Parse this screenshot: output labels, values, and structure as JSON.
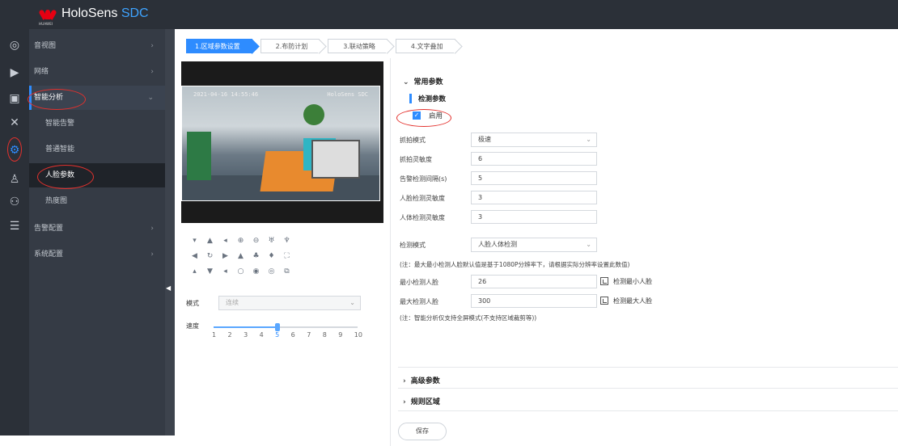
{
  "header": {
    "brand_main": "HoloSens ",
    "brand_accent": "SDC",
    "brand_sub": "HUAWEI"
  },
  "colors": {
    "accent": "#2e8cff",
    "highlight_ellipse": "#e3312d",
    "brand_red": "#e60012",
    "nav_bg": "#2b3038"
  },
  "icon_bar": [
    "camera-icon",
    "video-icon",
    "image-icon",
    "tools-icon",
    "gear-icon",
    "person-search-icon",
    "people-icon",
    "log-icon"
  ],
  "sidebar": {
    "items": [
      {
        "label": "音视图"
      },
      {
        "label": "网络"
      },
      {
        "label": "智能分析"
      },
      {
        "label": "智能告警"
      },
      {
        "label": "普通智能"
      },
      {
        "label": "人脸参数"
      },
      {
        "label": "热度图"
      },
      {
        "label": "告警配置"
      },
      {
        "label": "系统配置"
      }
    ]
  },
  "steps": [
    "1.区域参数设置",
    "2.布防计划",
    "3.联动策略",
    "4.文字叠加"
  ],
  "video": {
    "osd_time": "2021-04-16 14:55:46",
    "osd_brand": "HoloSens SDC"
  },
  "ptz": {
    "mode_label": "模式",
    "mode_value": "连续",
    "speed_label": "速度",
    "speed_value": 5,
    "speed_min": 1,
    "speed_max": 10,
    "speed_ticks": [
      "1",
      "2",
      "3",
      "4",
      "5",
      "6",
      "7",
      "8",
      "9",
      "10"
    ]
  },
  "panel": {
    "common_params": "常用参数",
    "detect_params": "检测参数",
    "enable_label": "启用",
    "enabled": true,
    "fields": [
      {
        "label": "抓拍模式",
        "value": "极速",
        "type": "select"
      },
      {
        "label": "抓拍灵敏度",
        "value": "6",
        "type": "input"
      },
      {
        "label": "告警检测间隔(s)",
        "value": "5",
        "type": "input"
      },
      {
        "label": "人脸检测灵敏度",
        "value": "3",
        "type": "input"
      },
      {
        "label": "人体检测灵敏度",
        "value": "3",
        "type": "input"
      }
    ],
    "detect_mode_label": "检测模式",
    "detect_mode_value": "人脸人体检测",
    "note1": "(注：最大最小检测人脸默认值是基于1080P分辨率下，请根据实际分辨率设置此数值)",
    "min_face_label": "最小检测人脸",
    "min_face_value": "26",
    "min_face_action": "检测最小人脸",
    "max_face_label": "最大检测人脸",
    "max_face_value": "300",
    "max_face_action": "检测最大人脸",
    "note2": "(注：智能分析仅支持全屏模式(不支持区域裁剪等))",
    "advanced_params": "高级参数",
    "rule_area": "规则区域",
    "save": "保存"
  }
}
